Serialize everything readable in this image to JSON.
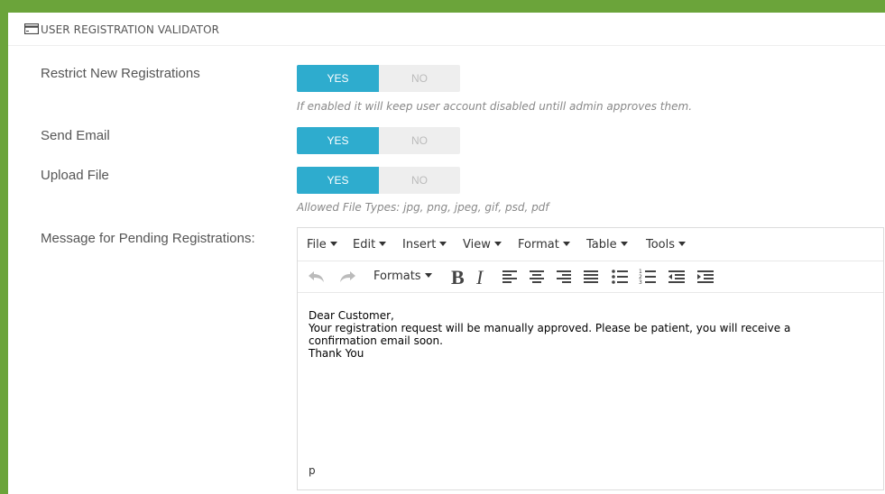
{
  "panel": {
    "title": "USER REGISTRATION VALIDATOR",
    "icon": "credit-card-icon"
  },
  "fields": {
    "restrict": {
      "label": "Restrict New Registrations",
      "yes": "YES",
      "no": "NO",
      "selected": "YES",
      "help": "If enabled it will keep user account disabled untill admin approves them."
    },
    "send_email": {
      "label": "Send Email",
      "yes": "YES",
      "no": "NO",
      "selected": "YES"
    },
    "upload_file": {
      "label": "Upload File",
      "yes": "YES",
      "no": "NO",
      "selected": "YES",
      "help": "Allowed File Types: jpg, png, jpeg, gif, psd, pdf"
    },
    "message": {
      "label": "Message for Pending Registrations:"
    }
  },
  "editor": {
    "menu": [
      "File",
      "Edit",
      "Insert",
      "View",
      "Format",
      "Table",
      "Tools"
    ],
    "formats_label": "Formats",
    "content_lines": [
      "Dear Customer,",
      "Your registration request will be manually approved. Please be patient, you will receive a",
      "confirmation email soon.",
      "Thank You"
    ],
    "status_path": "p"
  },
  "colors": {
    "frame": "#6ba43a",
    "toggle_on": "#2eacce",
    "toggle_off": "#eeeeee"
  }
}
